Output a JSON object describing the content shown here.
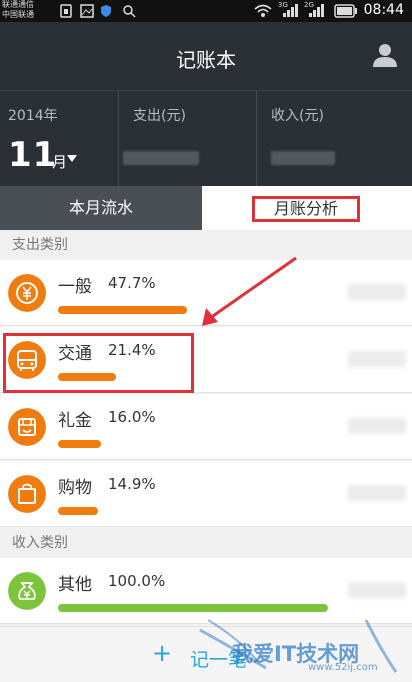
{
  "status_bar": {
    "carrier_line1": "联通通信",
    "carrier_line2": "中国联通",
    "time": "08:44",
    "network_1": "3G",
    "network_2": "2G"
  },
  "header": {
    "title": "记账本"
  },
  "summary": {
    "year": "2014年",
    "month": "11",
    "month_unit": "月",
    "expense_label": "支出(元)",
    "income_label": "收入(元)"
  },
  "tabs": {
    "monthly_flow": "本月流水",
    "monthly_analysis": "月账分析"
  },
  "expense_section": {
    "title": "支出类别",
    "items": [
      {
        "name": "一般",
        "percent": "47.7%",
        "ratio": 0.477,
        "icon": "yen-icon"
      },
      {
        "name": "交通",
        "percent": "21.4%",
        "ratio": 0.214,
        "icon": "bus-icon"
      },
      {
        "name": "礼金",
        "percent": "16.0%",
        "ratio": 0.16,
        "icon": "gift-icon"
      },
      {
        "name": "购物",
        "percent": "14.9%",
        "ratio": 0.149,
        "icon": "shopping-bag-icon"
      }
    ]
  },
  "income_section": {
    "title": "收入类别",
    "items": [
      {
        "name": "其他",
        "percent": "100.0%",
        "ratio": 1.0,
        "icon": "money-bag-icon"
      }
    ]
  },
  "bottom_bar": {
    "plus": "+",
    "add_label": "记一笔"
  },
  "watermark": {
    "text": "我爱IT技术网",
    "url": "www.52ij.com"
  },
  "colors": {
    "header_bg": "#2b2f36",
    "expense_accent": "#f07c10",
    "income_accent": "#7cc43b",
    "highlight": "#e0303a",
    "action_blue": "#2aa7d9"
  }
}
